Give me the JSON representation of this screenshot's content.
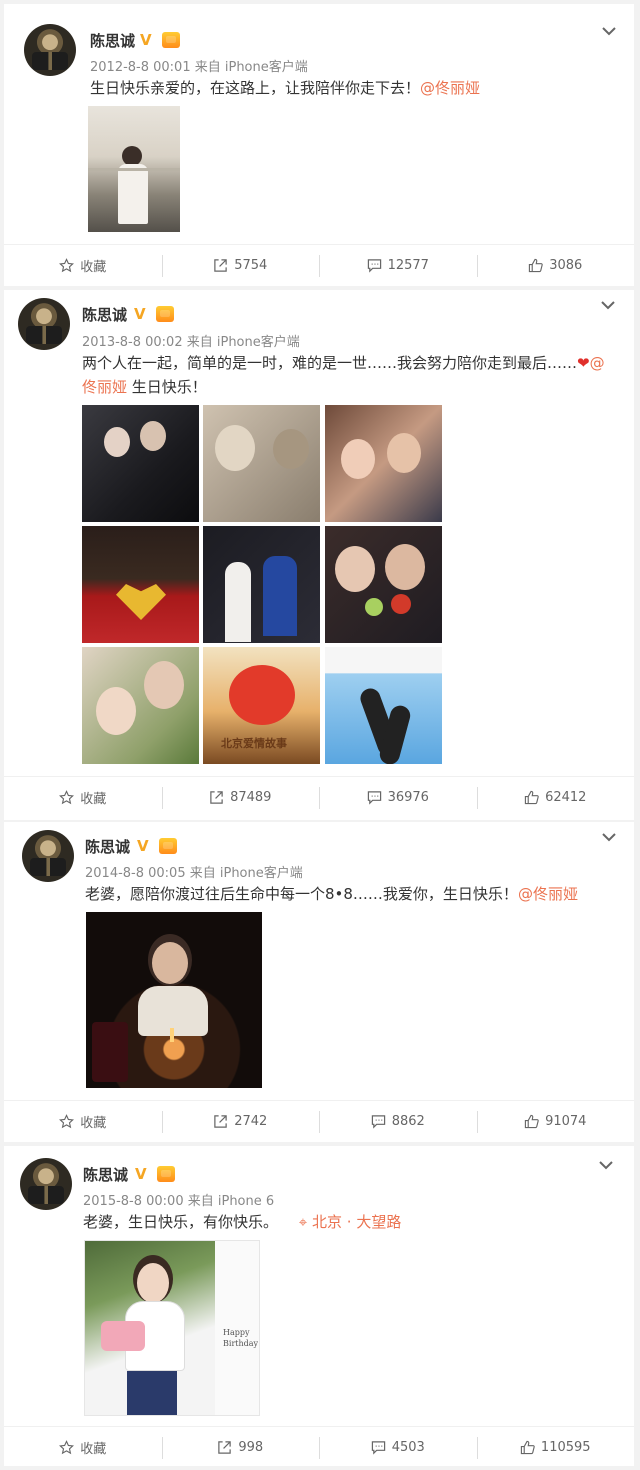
{
  "posts": [
    {
      "username": "陈思诚",
      "meta": "2012-8-8 00:01 来自 iPhone客户端",
      "text": "生日快乐亲爱的，在这路上，让我陪伴你走下去！",
      "mention": "@佟丽娅",
      "actions": {
        "favorite": "收藏",
        "repost": "5754",
        "comment": "12577",
        "like": "3086"
      }
    },
    {
      "username": "陈思诚",
      "meta": "2013-8-8 00:02 来自 iPhone客户端",
      "text": "两个人在一起，简单的是一时，难的是一世……我会努力陪你走到最后……",
      "mention": "@",
      "mention_line2": "佟丽娅",
      "text_after": " 生日快乐！",
      "photo_caption": "北京爱情故事",
      "actions": {
        "favorite": "收藏",
        "repost": "87489",
        "comment": "36976",
        "like": "62412"
      }
    },
    {
      "username": "陈思诚",
      "meta": "2014-8-8 00:05 来自 iPhone客户端",
      "text": "老婆，愿陪你渡过往后生命中每一个8•8……我爱你，生日快乐！",
      "mention": "@佟丽娅",
      "actions": {
        "favorite": "收藏",
        "repost": "2742",
        "comment": "8862",
        "like": "91074"
      }
    },
    {
      "username": "陈思诚",
      "meta": "2015-8-8 00:00 来自 iPhone 6",
      "text": "老婆，生日快乐，有你快乐。",
      "location": "北京 · 大望路",
      "photo_caption": "Happy Birthday",
      "actions": {
        "favorite": "收藏",
        "repost": "998",
        "comment": "4503",
        "like": "110595"
      }
    }
  ],
  "colors": {
    "accent": "#eb7350",
    "vip": "#f5a623",
    "background": "#f2f2f2"
  }
}
